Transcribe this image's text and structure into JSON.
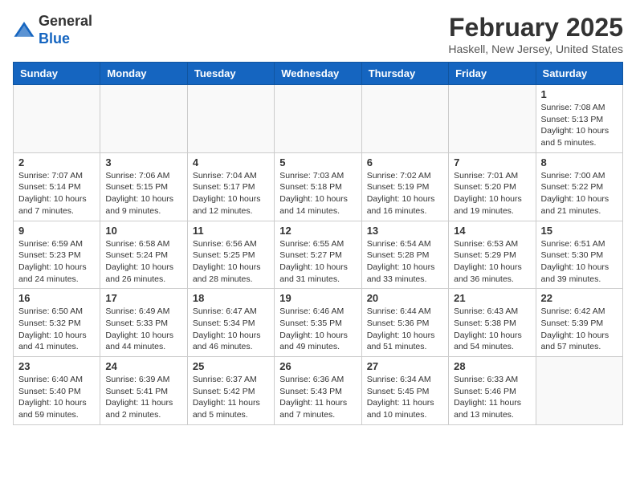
{
  "header": {
    "logo_line1": "General",
    "logo_line2": "Blue",
    "month_title": "February 2025",
    "location": "Haskell, New Jersey, United States"
  },
  "weekdays": [
    "Sunday",
    "Monday",
    "Tuesday",
    "Wednesday",
    "Thursday",
    "Friday",
    "Saturday"
  ],
  "weeks": [
    [
      {
        "day": "",
        "info": ""
      },
      {
        "day": "",
        "info": ""
      },
      {
        "day": "",
        "info": ""
      },
      {
        "day": "",
        "info": ""
      },
      {
        "day": "",
        "info": ""
      },
      {
        "day": "",
        "info": ""
      },
      {
        "day": "1",
        "info": "Sunrise: 7:08 AM\nSunset: 5:13 PM\nDaylight: 10 hours\nand 5 minutes."
      }
    ],
    [
      {
        "day": "2",
        "info": "Sunrise: 7:07 AM\nSunset: 5:14 PM\nDaylight: 10 hours\nand 7 minutes."
      },
      {
        "day": "3",
        "info": "Sunrise: 7:06 AM\nSunset: 5:15 PM\nDaylight: 10 hours\nand 9 minutes."
      },
      {
        "day": "4",
        "info": "Sunrise: 7:04 AM\nSunset: 5:17 PM\nDaylight: 10 hours\nand 12 minutes."
      },
      {
        "day": "5",
        "info": "Sunrise: 7:03 AM\nSunset: 5:18 PM\nDaylight: 10 hours\nand 14 minutes."
      },
      {
        "day": "6",
        "info": "Sunrise: 7:02 AM\nSunset: 5:19 PM\nDaylight: 10 hours\nand 16 minutes."
      },
      {
        "day": "7",
        "info": "Sunrise: 7:01 AM\nSunset: 5:20 PM\nDaylight: 10 hours\nand 19 minutes."
      },
      {
        "day": "8",
        "info": "Sunrise: 7:00 AM\nSunset: 5:22 PM\nDaylight: 10 hours\nand 21 minutes."
      }
    ],
    [
      {
        "day": "9",
        "info": "Sunrise: 6:59 AM\nSunset: 5:23 PM\nDaylight: 10 hours\nand 24 minutes."
      },
      {
        "day": "10",
        "info": "Sunrise: 6:58 AM\nSunset: 5:24 PM\nDaylight: 10 hours\nand 26 minutes."
      },
      {
        "day": "11",
        "info": "Sunrise: 6:56 AM\nSunset: 5:25 PM\nDaylight: 10 hours\nand 28 minutes."
      },
      {
        "day": "12",
        "info": "Sunrise: 6:55 AM\nSunset: 5:27 PM\nDaylight: 10 hours\nand 31 minutes."
      },
      {
        "day": "13",
        "info": "Sunrise: 6:54 AM\nSunset: 5:28 PM\nDaylight: 10 hours\nand 33 minutes."
      },
      {
        "day": "14",
        "info": "Sunrise: 6:53 AM\nSunset: 5:29 PM\nDaylight: 10 hours\nand 36 minutes."
      },
      {
        "day": "15",
        "info": "Sunrise: 6:51 AM\nSunset: 5:30 PM\nDaylight: 10 hours\nand 39 minutes."
      }
    ],
    [
      {
        "day": "16",
        "info": "Sunrise: 6:50 AM\nSunset: 5:32 PM\nDaylight: 10 hours\nand 41 minutes."
      },
      {
        "day": "17",
        "info": "Sunrise: 6:49 AM\nSunset: 5:33 PM\nDaylight: 10 hours\nand 44 minutes."
      },
      {
        "day": "18",
        "info": "Sunrise: 6:47 AM\nSunset: 5:34 PM\nDaylight: 10 hours\nand 46 minutes."
      },
      {
        "day": "19",
        "info": "Sunrise: 6:46 AM\nSunset: 5:35 PM\nDaylight: 10 hours\nand 49 minutes."
      },
      {
        "day": "20",
        "info": "Sunrise: 6:44 AM\nSunset: 5:36 PM\nDaylight: 10 hours\nand 51 minutes."
      },
      {
        "day": "21",
        "info": "Sunrise: 6:43 AM\nSunset: 5:38 PM\nDaylight: 10 hours\nand 54 minutes."
      },
      {
        "day": "22",
        "info": "Sunrise: 6:42 AM\nSunset: 5:39 PM\nDaylight: 10 hours\nand 57 minutes."
      }
    ],
    [
      {
        "day": "23",
        "info": "Sunrise: 6:40 AM\nSunset: 5:40 PM\nDaylight: 10 hours\nand 59 minutes."
      },
      {
        "day": "24",
        "info": "Sunrise: 6:39 AM\nSunset: 5:41 PM\nDaylight: 11 hours\nand 2 minutes."
      },
      {
        "day": "25",
        "info": "Sunrise: 6:37 AM\nSunset: 5:42 PM\nDaylight: 11 hours\nand 5 minutes."
      },
      {
        "day": "26",
        "info": "Sunrise: 6:36 AM\nSunset: 5:43 PM\nDaylight: 11 hours\nand 7 minutes."
      },
      {
        "day": "27",
        "info": "Sunrise: 6:34 AM\nSunset: 5:45 PM\nDaylight: 11 hours\nand 10 minutes."
      },
      {
        "day": "28",
        "info": "Sunrise: 6:33 AM\nSunset: 5:46 PM\nDaylight: 11 hours\nand 13 minutes."
      },
      {
        "day": "",
        "info": ""
      }
    ]
  ]
}
